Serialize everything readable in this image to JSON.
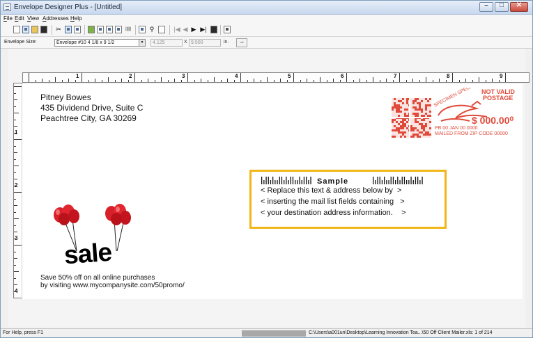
{
  "window": {
    "title": "Envelope Designer Plus - [Untitled]"
  },
  "menu": {
    "items": [
      "File",
      "Edit",
      "View",
      "Addresses",
      "Help"
    ]
  },
  "toolbar": {
    "buttons": [
      "new-icon",
      "wizard-icon",
      "open-icon",
      "save-icon",
      "cut-icon",
      "copy-icon",
      "paste-icon",
      "properties-icon",
      "envelope-layout-1-icon",
      "envelope-layout-2-icon",
      "envelope-layout-3-icon",
      "barcode-icon",
      "zoom-fit-icon",
      "zoom-icon",
      "preview-icon",
      "first-record-icon",
      "previous-record-icon",
      "next-record-icon",
      "last-record-icon",
      "list-icon",
      "print-icon"
    ]
  },
  "envelope_size": {
    "label": "Envelope Size:",
    "selected": "Envelope #10 4 1/8 x 9 1/2",
    "width": "4.125",
    "height": "9.500",
    "unit": "in.",
    "apply_label": "⇒"
  },
  "rulers": {
    "horizontal_numbers": [
      "1",
      "2",
      "3",
      "4",
      "5",
      "6",
      "7",
      "8",
      "9"
    ],
    "vertical_numbers": [
      "1",
      "2",
      "3",
      "4"
    ]
  },
  "return_address": {
    "line1": "Pitney Bowes",
    "line2": "435 Dividend Drive, Suite C",
    "line3": "Peachtree City, GA 30269"
  },
  "indicia": {
    "line1": "NOT VALID",
    "line2": "POSTAGE",
    "amount": "$ 000.00⁰",
    "pb_line": "PB 00    JAN 00 0000",
    "zip_line": "MAILED FROM ZIP CODE 00000",
    "specimen": "SPECIMEN SPECIMEN",
    "color": "#e04a3a"
  },
  "address_block": {
    "sample_label": "Sample",
    "line1": "< Replace this text & address below by  >",
    "line2": "< inserting the mail list fields containing   >",
    "line3": "< your destination address information.    >",
    "border_color": "#f2b619"
  },
  "promo": {
    "sale_word": "sale",
    "line1": "Save 50% off on all online purchases",
    "line2": "by visiting www.mycompanysite.com/50promo/"
  },
  "status": {
    "help_text": "For Help, press F1",
    "file_info": "C:\\Users\\a001un\\Desktop\\Learning Innovation Tea...\\50 Off Client Mailer.xls: 1 of 214"
  }
}
